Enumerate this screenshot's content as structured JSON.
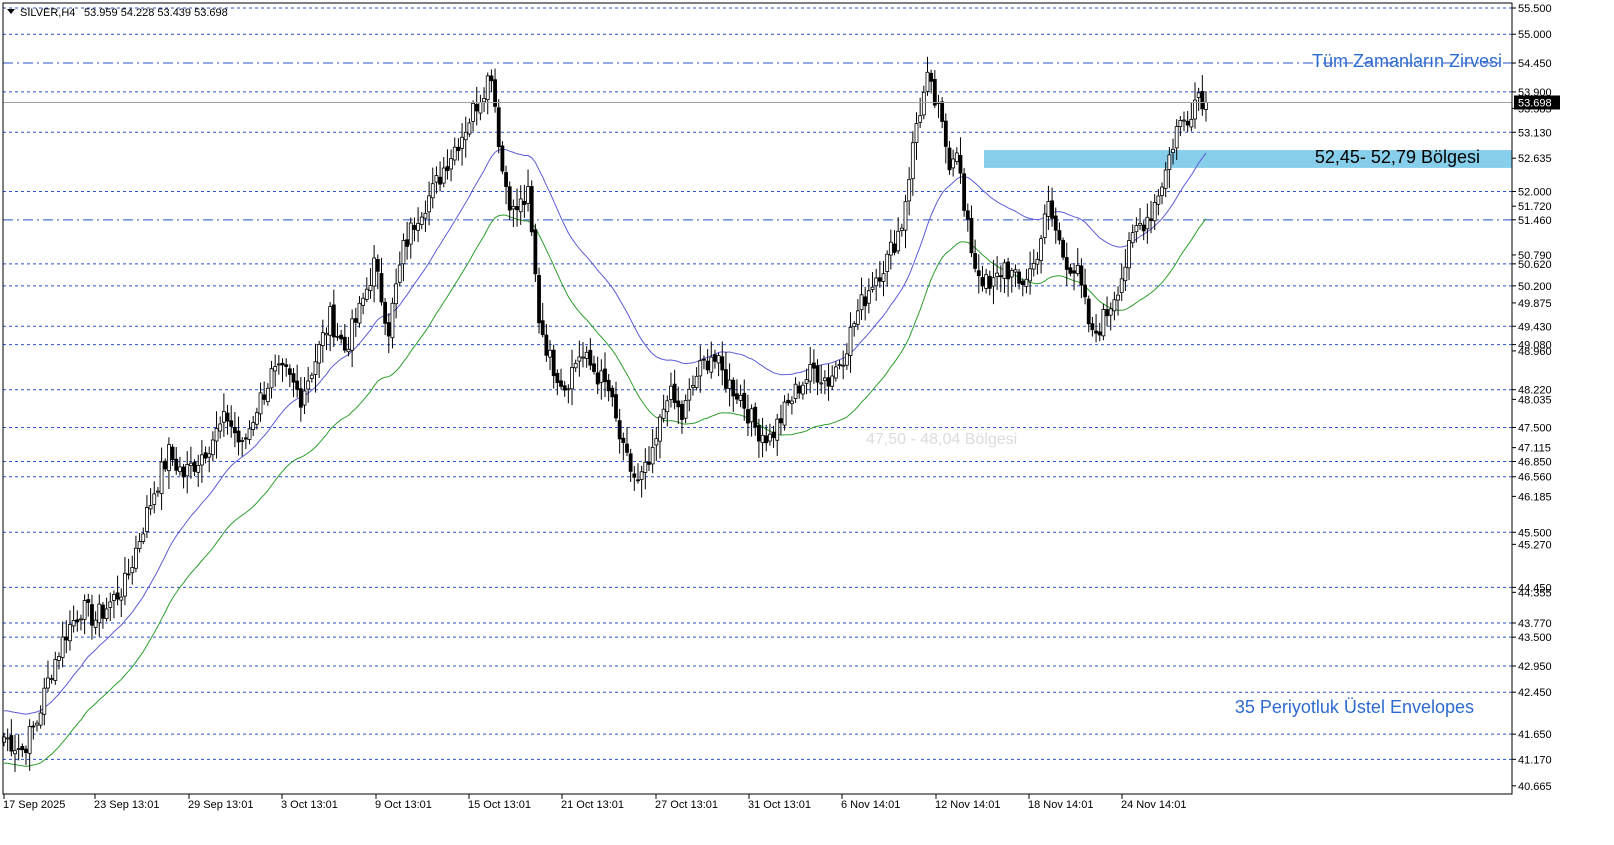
{
  "header": {
    "symbol": "SILVER,H4",
    "ohlc": "53.959 54.228 53.439 53.698"
  },
  "colors": {
    "background": "#ffffff",
    "candle": "#000000",
    "level_line": "#2a52c9",
    "envelope_upper": "#5c5cd6",
    "envelope_lower": "#2e9e2e",
    "zone_fill": "#87ceeb",
    "annotation_blue": "#2e6bd0",
    "price_marker_bg": "#000000",
    "price_marker_text": "#ffffff"
  },
  "chart_data": {
    "type": "candlestick",
    "symbol": "SILVER",
    "timeframe": "H4",
    "last_price": 53.698,
    "ylim": [
      40.3,
      55.6
    ],
    "x_ticks": [
      "17 Sep 2025",
      "23 Sep 13:01",
      "29 Sep 13:01",
      "3 Oct 13:01",
      "9 Oct 13:01",
      "15 Oct 13:01",
      "21 Oct 13:01",
      "27 Oct 13:01",
      "31 Oct 13:01",
      "6 Nov 14:01",
      "12 Nov 14:01",
      "18 Nov 14:01",
      "24 Nov 14:01"
    ],
    "y_ticks": [
      "55.500",
      "55.000",
      "54.450",
      "53.900",
      "53.585",
      "53.130",
      "52.635",
      "52.000",
      "51.720",
      "51.460",
      "50.790",
      "50.620",
      "50.200",
      "49.875",
      "49.430",
      "49.080",
      "48.960",
      "48.220",
      "48.035",
      "47.500",
      "47.115",
      "46.850",
      "46.560",
      "46.185",
      "45.500",
      "45.270",
      "44.450",
      "44.355",
      "43.770",
      "43.500",
      "42.950",
      "42.450",
      "41.650",
      "41.170",
      "40.665"
    ],
    "dashdot_levels": [
      "54.450",
      "51.460"
    ],
    "dotted_levels": [
      "55.500",
      "55.000",
      "53.900",
      "53.130",
      "52.000",
      "50.620",
      "50.200",
      "49.430",
      "49.080",
      "48.220",
      "47.500",
      "46.850",
      "46.560",
      "45.500",
      "44.450",
      "43.770",
      "43.500",
      "42.950",
      "42.450",
      "41.650",
      "41.170"
    ],
    "zone": {
      "low": 52.45,
      "high": 52.79,
      "label": "52,45- 52,79 Bölgesi"
    },
    "faint_zone_label": "47,50 - 48,04 Bölgesi",
    "annotations": {
      "ath": "Tüm Zamanların Zirvesi",
      "envelope": "35 Periyotluk Üstel Envelopes"
    },
    "close_path": [
      [
        0,
        41.6
      ],
      [
        5,
        41.35
      ],
      [
        9,
        41.9
      ],
      [
        13,
        42.9
      ],
      [
        17,
        43.6
      ],
      [
        21,
        44.05
      ],
      [
        25,
        43.85
      ],
      [
        29,
        44.15
      ],
      [
        33,
        44.5
      ],
      [
        37,
        45.4
      ],
      [
        41,
        46.3
      ],
      [
        45,
        47.0
      ],
      [
        49,
        46.6
      ],
      [
        53,
        46.9
      ],
      [
        57,
        47.3
      ],
      [
        61,
        47.7
      ],
      [
        65,
        47.1
      ],
      [
        69,
        47.9
      ],
      [
        73,
        48.5
      ],
      [
        77,
        48.5
      ],
      [
        81,
        48.1
      ],
      [
        85,
        48.8
      ],
      [
        89,
        49.6
      ],
      [
        93,
        49.0
      ],
      [
        97,
        49.7
      ],
      [
        101,
        50.6
      ],
      [
        105,
        49.4
      ],
      [
        109,
        50.9
      ],
      [
        113,
        51.6
      ],
      [
        117,
        52.0
      ],
      [
        121,
        52.6
      ],
      [
        125,
        53.1
      ],
      [
        129,
        53.7
      ],
      [
        133,
        54.3
      ],
      [
        136,
        52.4
      ],
      [
        139,
        51.6
      ],
      [
        143,
        51.9
      ],
      [
        146,
        49.6
      ],
      [
        149,
        48.8
      ],
      [
        153,
        48.3
      ],
      [
        157,
        48.9
      ],
      [
        161,
        48.6
      ],
      [
        165,
        48.2
      ],
      [
        169,
        47.0
      ],
      [
        173,
        46.4
      ],
      [
        177,
        46.9
      ],
      [
        181,
        48.2
      ],
      [
        185,
        47.7
      ],
      [
        189,
        48.5
      ],
      [
        193,
        48.9
      ],
      [
        197,
        48.4
      ],
      [
        201,
        48.1
      ],
      [
        205,
        47.5
      ],
      [
        209,
        47.3
      ],
      [
        213,
        47.8
      ],
      [
        217,
        48.3
      ],
      [
        221,
        48.6
      ],
      [
        225,
        48.4
      ],
      [
        229,
        48.9
      ],
      [
        233,
        49.7
      ],
      [
        237,
        50.3
      ],
      [
        241,
        50.7
      ],
      [
        245,
        51.4
      ],
      [
        249,
        53.3
      ],
      [
        252,
        54.1
      ],
      [
        255,
        53.5
      ],
      [
        258,
        52.6
      ],
      [
        260,
        52.9
      ],
      [
        262,
        51.6
      ],
      [
        265,
        50.6
      ],
      [
        269,
        50.1
      ],
      [
        273,
        50.6
      ],
      [
        277,
        50.2
      ],
      [
        281,
        50.6
      ],
      [
        285,
        51.7
      ],
      [
        289,
        50.8
      ],
      [
        293,
        50.4
      ],
      [
        297,
        49.2
      ],
      [
        301,
        49.7
      ],
      [
        305,
        50.4
      ],
      [
        309,
        51.3
      ],
      [
        313,
        51.6
      ],
      [
        317,
        52.4
      ],
      [
        320,
        53.2
      ],
      [
        323,
        53.45
      ],
      [
        326,
        53.9
      ],
      [
        328,
        53.7
      ]
    ],
    "candle_range": {
      "first_index": 0,
      "last_index": 328,
      "count": 329
    }
  }
}
